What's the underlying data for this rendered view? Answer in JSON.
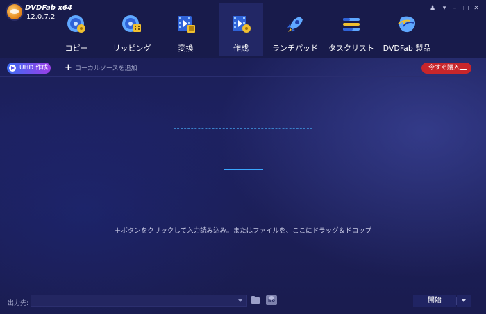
{
  "app": {
    "name": "DVDFab x64",
    "version": "12.0.7.2"
  },
  "window_controls": [
    "pin-icon",
    "menu-arrow-icon",
    "minimize-icon",
    "maximize-icon",
    "close-icon"
  ],
  "nav": {
    "items": [
      {
        "label": "コピー",
        "icon": "disc-copy-icon",
        "active": false
      },
      {
        "label": "リッピング",
        "icon": "disc-ripper-icon",
        "active": false
      },
      {
        "label": "変換",
        "icon": "film-convert-icon",
        "active": false
      },
      {
        "label": "作成",
        "icon": "film-create-icon",
        "active": true
      },
      {
        "label": "ランチパッド",
        "icon": "rocket-icon",
        "active": false
      },
      {
        "label": "タスクリスト",
        "icon": "task-list-icon",
        "active": false
      },
      {
        "label": "DVDFab 製品",
        "icon": "product-icon",
        "active": false
      }
    ]
  },
  "toolbar": {
    "uhd_button": "UHD 作成",
    "add_local_source": "ローカルソースを追加",
    "buy_button": "今すぐ購入"
  },
  "main": {
    "drop_hint": "＋ボタンをクリックして入力読み込み。またはファイルを、ここにドラッグ＆ドロップ"
  },
  "bottom": {
    "output_label": "出力先:",
    "output_value": "",
    "start_button": "開始"
  },
  "colors": {
    "accent_blue": "#3aa7ff",
    "buy_red": "#c8262b",
    "uhd_gradient_start": "#3d6cf2",
    "uhd_gradient_end": "#9a3ee6"
  }
}
